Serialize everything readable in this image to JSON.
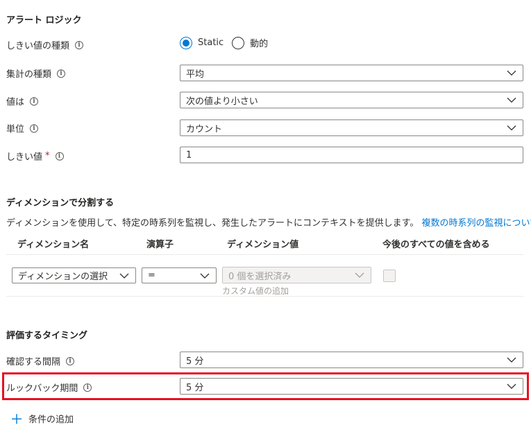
{
  "alert_logic": {
    "title": "アラート ロジック",
    "threshold_type": {
      "label": "しきい値の種類",
      "options": [
        {
          "label": "Static",
          "selected": true
        },
        {
          "label": "動的",
          "selected": false
        }
      ]
    },
    "aggregation_type": {
      "label": "集計の種類",
      "value": "平均"
    },
    "operator": {
      "label": "値は",
      "value": "次の値より小さい"
    },
    "unit": {
      "label": "単位",
      "value": "カウント"
    },
    "threshold_value": {
      "label": "しきい値",
      "required_mark": "*",
      "value": "1"
    }
  },
  "dimensions": {
    "title": "ディメンションで分割する",
    "description": "ディメンションを使用して、特定の時系列を監視し、発生したアラートにコンテキストを提供します。",
    "link_text": "複数の時系列の監視について",
    "columns": [
      "ディメンション名",
      "演算子",
      "ディメンション値",
      "今後のすべての値を含める"
    ],
    "row": {
      "name_placeholder": "ディメンションの選択",
      "operator_value": "=",
      "values_placeholder": "0 個を選択済み",
      "custom_value_hint": "カスタム値の追加",
      "include_future": false
    }
  },
  "evaluation": {
    "title": "評価するタイミング",
    "check_every": {
      "label": "確認する間隔",
      "value": "5 分"
    },
    "lookback": {
      "label": "ルックバック期間",
      "value": "5 分"
    }
  },
  "add_condition": {
    "label": "条件の追加"
  },
  "colors": {
    "accent": "#0078d4",
    "highlight": "#e81123",
    "required": "#a4262c"
  }
}
